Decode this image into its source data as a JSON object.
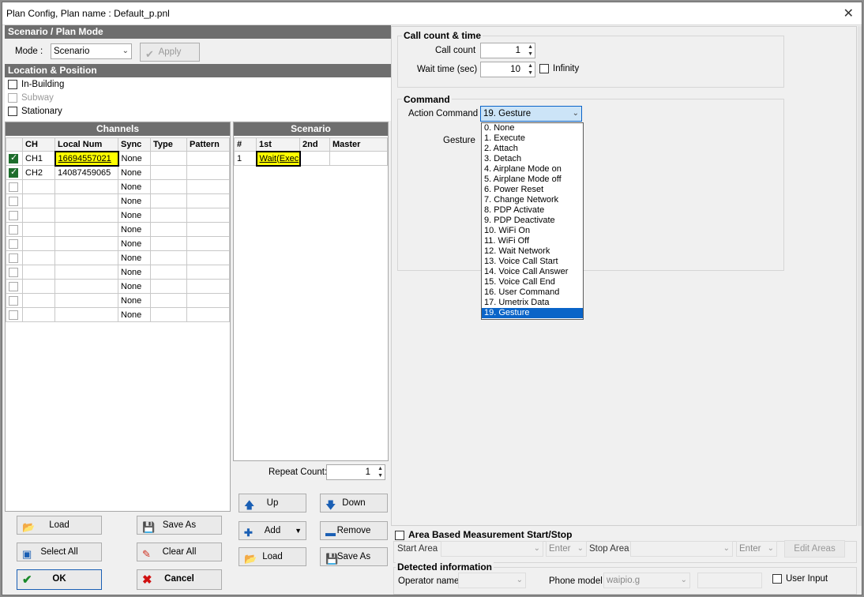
{
  "window": {
    "title": "Plan Config, Plan name : Default_p.pnl",
    "close": "✕"
  },
  "scenario_mode": {
    "header": "Scenario / Plan Mode",
    "mode_label": "Mode :",
    "mode_value": "Scenario",
    "apply": "Apply"
  },
  "location": {
    "header": "Location & Position",
    "options": [
      "In-Building",
      "Subway",
      "Stationary"
    ]
  },
  "channels": {
    "header": "Channels",
    "columns": [
      "CH",
      "Local Num",
      "Sync",
      "Type",
      "Pattern"
    ],
    "rows": [
      {
        "ch": "CH1",
        "num": "16694557021",
        "sync": "None"
      },
      {
        "ch": "CH2",
        "num": "14087459065",
        "sync": "None"
      },
      {
        "ch": "",
        "num": "",
        "sync": "None"
      },
      {
        "ch": "",
        "num": "",
        "sync": "None"
      },
      {
        "ch": "",
        "num": "",
        "sync": "None"
      },
      {
        "ch": "",
        "num": "",
        "sync": "None"
      },
      {
        "ch": "",
        "num": "",
        "sync": "None"
      },
      {
        "ch": "",
        "num": "",
        "sync": "None"
      },
      {
        "ch": "",
        "num": "",
        "sync": "None"
      },
      {
        "ch": "",
        "num": "",
        "sync": "None"
      },
      {
        "ch": "",
        "num": "",
        "sync": "None"
      },
      {
        "ch": "",
        "num": "",
        "sync": "None"
      }
    ]
  },
  "scenario": {
    "header": "Scenario",
    "columns": [
      "#",
      "1st",
      "2nd",
      "Master"
    ],
    "rows": [
      {
        "n": "1",
        "first": "Wait(Exec"
      }
    ],
    "repeat_label": "Repeat Count:",
    "repeat_value": "1"
  },
  "buttons": {
    "load": "Load",
    "save_as": "Save As",
    "select_all": "Select All",
    "clear_all": "Clear All",
    "ok": "OK",
    "cancel": "Cancel",
    "up": "Up",
    "down": "Down",
    "add": "Add",
    "remove": "Remove",
    "scn_load": "Load",
    "scn_save_as": "Save As"
  },
  "call": {
    "title": "Call count & time",
    "count_label": "Call count",
    "count_value": "1",
    "wait_label": "Wait time (sec)",
    "wait_value": "10",
    "infinity": "Infinity"
  },
  "command": {
    "title": "Command",
    "action_label": "Action Command",
    "action_value": "19. Gesture",
    "gesture_label": "Gesture",
    "options": [
      "0. None",
      "1. Execute",
      "2. Attach",
      "3. Detach",
      "4. Airplane Mode on",
      "5. Airplane Mode off",
      "6. Power Reset",
      "7. Change Network",
      "8. PDP Activate",
      "9. PDP Deactivate",
      "10. WiFi On",
      "11. WiFi Off",
      "12. Wait Network",
      "13. Voice Call Start",
      "14. Voice Call Answer",
      "15. Voice Call End",
      "16. User Command",
      "17. Umetrix Data",
      "19. Gesture"
    ]
  },
  "area": {
    "title": "Area Based Measurement Start/Stop",
    "start_label": "Start Area",
    "enter": "Enter",
    "stop_label": "Stop Area",
    "enter2": "Enter",
    "edit": "Edit Areas"
  },
  "detected": {
    "title": "Detected information",
    "operator_label": "Operator name",
    "phone_label": "Phone model",
    "phone_value": "waipio.g",
    "user_input": "User Input"
  }
}
